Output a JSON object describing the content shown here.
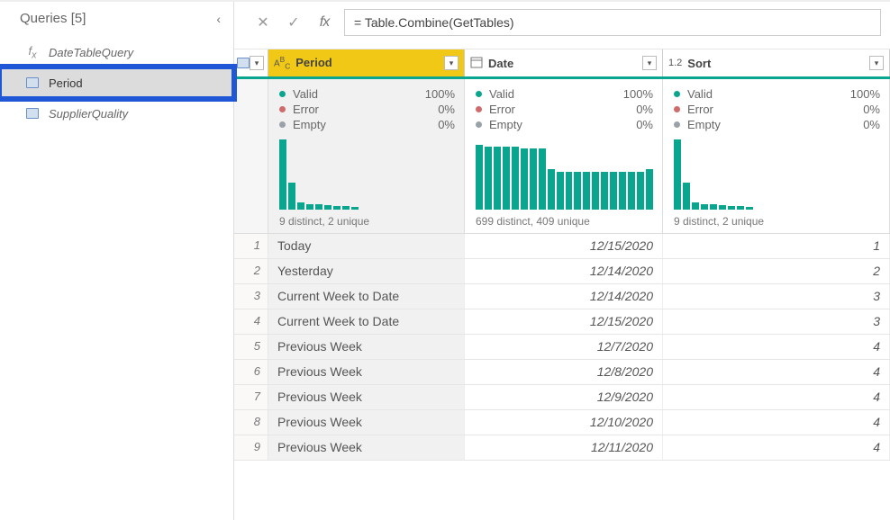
{
  "sidebar": {
    "title": "Queries [5]",
    "items": [
      {
        "label": "DateTableQuery",
        "type": "fx"
      },
      {
        "label": "Period",
        "type": "table",
        "selected": true
      },
      {
        "label": "SupplierQuality",
        "type": "table"
      }
    ]
  },
  "formula_bar": {
    "value": "= Table.Combine(GetTables)",
    "fx_label": "fx"
  },
  "columns": [
    {
      "name": "Period",
      "type_label": "ABC",
      "selected": true
    },
    {
      "name": "Date",
      "type_label": "📅"
    },
    {
      "name": "Sort",
      "type_label": "1.2"
    }
  ],
  "quality": {
    "labels": {
      "valid": "Valid",
      "error": "Error",
      "empty": "Empty"
    },
    "cols": [
      {
        "valid": "100%",
        "error": "0%",
        "empty": "0%",
        "distinct": "9 distinct, 2 unique"
      },
      {
        "valid": "100%",
        "error": "0%",
        "empty": "0%",
        "distinct": "699 distinct, 409 unique"
      },
      {
        "valid": "100%",
        "error": "0%",
        "empty": "0%",
        "distinct": "9 distinct, 2 unique"
      }
    ]
  },
  "rows": [
    {
      "n": "1",
      "period": "Today",
      "date": "12/15/2020",
      "sort": "1"
    },
    {
      "n": "2",
      "period": "Yesterday",
      "date": "12/14/2020",
      "sort": "2"
    },
    {
      "n": "3",
      "period": "Current Week to Date",
      "date": "12/14/2020",
      "sort": "3"
    },
    {
      "n": "4",
      "period": "Current Week to Date",
      "date": "12/15/2020",
      "sort": "3"
    },
    {
      "n": "5",
      "period": "Previous Week",
      "date": "12/7/2020",
      "sort": "4"
    },
    {
      "n": "6",
      "period": "Previous Week",
      "date": "12/8/2020",
      "sort": "4"
    },
    {
      "n": "7",
      "period": "Previous Week",
      "date": "12/9/2020",
      "sort": "4"
    },
    {
      "n": "8",
      "period": "Previous Week",
      "date": "12/10/2020",
      "sort": "4"
    },
    {
      "n": "9",
      "period": "Previous Week",
      "date": "12/11/2020",
      "sort": "4"
    }
  ],
  "chart_data": [
    {
      "type": "bar",
      "title": "Period distribution",
      "distinct": 9,
      "unique": 2,
      "values": [
        78,
        30,
        8,
        6,
        6,
        5,
        4,
        4,
        3
      ]
    },
    {
      "type": "bar",
      "title": "Date distribution",
      "distinct": 699,
      "unique": 409,
      "values": [
        72,
        70,
        70,
        70,
        70,
        68,
        68,
        68,
        45,
        42,
        42,
        42,
        42,
        42,
        42,
        42,
        42,
        42,
        42,
        45
      ]
    },
    {
      "type": "bar",
      "title": "Sort distribution",
      "distinct": 9,
      "unique": 2,
      "values": [
        78,
        30,
        8,
        6,
        6,
        5,
        4,
        4,
        3
      ]
    }
  ]
}
